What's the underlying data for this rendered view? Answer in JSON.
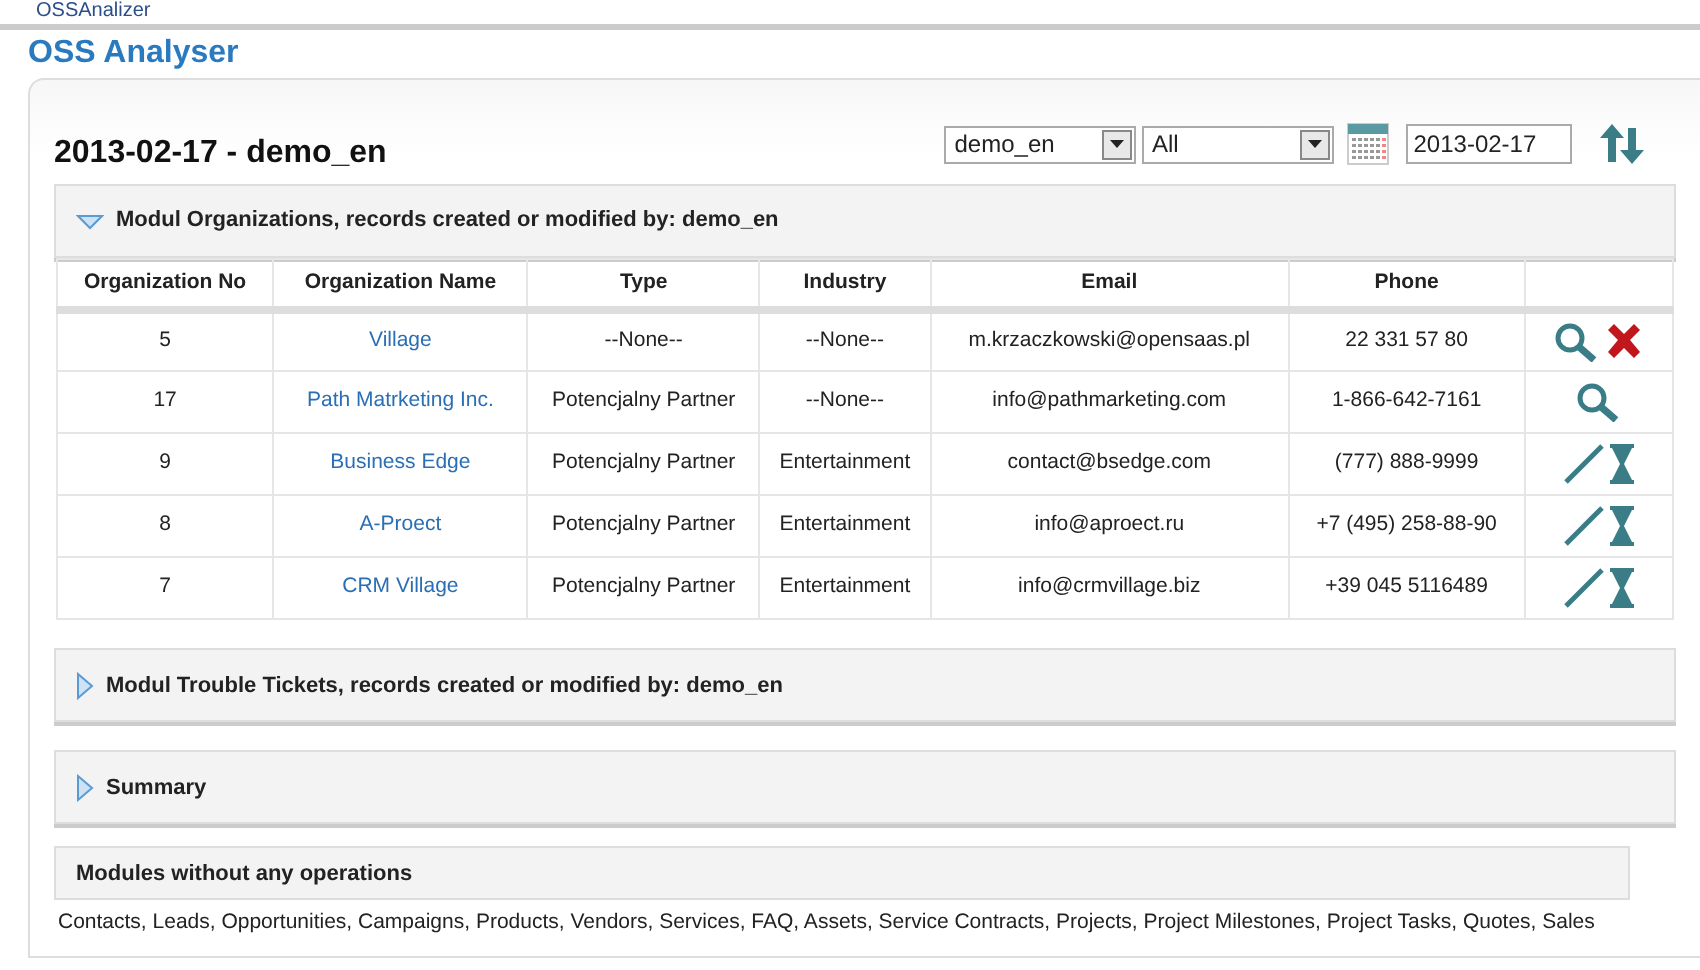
{
  "window": {
    "tab_title": "OSSAnalizer",
    "title": "OSS Analyser"
  },
  "report": {
    "heading": "2013-02-17 - demo_en",
    "user_select": "demo_en",
    "module_select": "All",
    "date": "2013-02-17"
  },
  "sections": [
    {
      "title": "Modul Organizations, records created or modified by: demo_en",
      "expanded": true,
      "table": {
        "columns": [
          "Organization No",
          "Organization Name",
          "Type",
          "Industry",
          "Email",
          "Phone",
          ""
        ],
        "rows": [
          {
            "no": "5",
            "name": "Village",
            "type": "--None--",
            "industry": "--None--",
            "email": "m.krzaczkowski@opensaas.pl",
            "phone": "22 331 57 80",
            "actions": [
              {
                "kind": "view"
              },
              {
                "kind": "delete"
              }
            ]
          },
          {
            "no": "17",
            "name": "Path Matrketing Inc.",
            "type": "Potencjalny Partner",
            "industry": "--None--",
            "email": "info@pathmarketing.com",
            "phone": "1-866-642-7161",
            "actions": [
              {
                "kind": "view"
              }
            ]
          },
          {
            "no": "9",
            "name": "Business Edge",
            "type": "Potencjalny Partner",
            "industry": "Entertainment",
            "email": "contact@bsedge.com",
            "phone": "(777) 888-9999",
            "actions": [
              {
                "kind": "edit"
              },
              {
                "kind": "history"
              }
            ]
          },
          {
            "no": "8",
            "name": "A-Proect",
            "type": "Potencjalny Partner",
            "industry": "Entertainment",
            "email": "info@aproect.ru",
            "phone": "+7 (495) 258-88-90",
            "actions": [
              {
                "kind": "edit"
              },
              {
                "kind": "history"
              }
            ]
          },
          {
            "no": "7",
            "name": "CRM Village",
            "type": "Potencjalny Partner",
            "industry": "Entertainment",
            "email": "info@crmvillage.biz",
            "phone": "+39 045 5116489",
            "actions": [
              {
                "kind": "edit"
              },
              {
                "kind": "history"
              }
            ]
          }
        ]
      }
    },
    {
      "title": "Modul Trouble Tickets, records created or modified by: demo_en",
      "expanded": false
    },
    {
      "title": "Summary",
      "expanded": false
    }
  ],
  "modules_without_operations": {
    "title": "Modules without any operations",
    "text": "Contacts, Leads, Opportunities, Campaigns, Products, Vendors, Services, FAQ, Assets, Service Contracts, Projects, Project Milestones, Project Tasks, Quotes, Sales"
  }
}
